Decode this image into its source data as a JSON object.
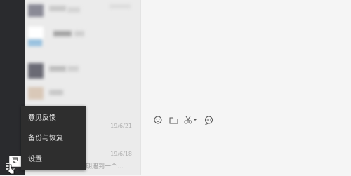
{
  "sidebar": {
    "menu_icon": "hamburger-menu-icon",
    "tooltip": "更多"
  },
  "conversation_list": {
    "dates": [
      "19/6/21",
      "19/6/18"
    ],
    "snippet": "…期遇到一个…"
  },
  "menu": {
    "items": [
      {
        "label": "意见反馈",
        "icon": "feedback-icon"
      },
      {
        "label": "备份与恢复",
        "icon": "backup-icon"
      },
      {
        "label": "设置",
        "icon": "settings-icon"
      }
    ]
  },
  "chat": {
    "toolbar": [
      {
        "icon": "emoji-icon"
      },
      {
        "icon": "folder-icon"
      },
      {
        "icon": "scissors-icon"
      },
      {
        "icon": "chat-bubble-icon"
      }
    ]
  },
  "colors": {
    "sidebar_bg": "#2a2b2e",
    "list_bg": "#ebebeb",
    "chat_bg": "#f5f5f5",
    "menu_bg": "#2e2e2e"
  }
}
